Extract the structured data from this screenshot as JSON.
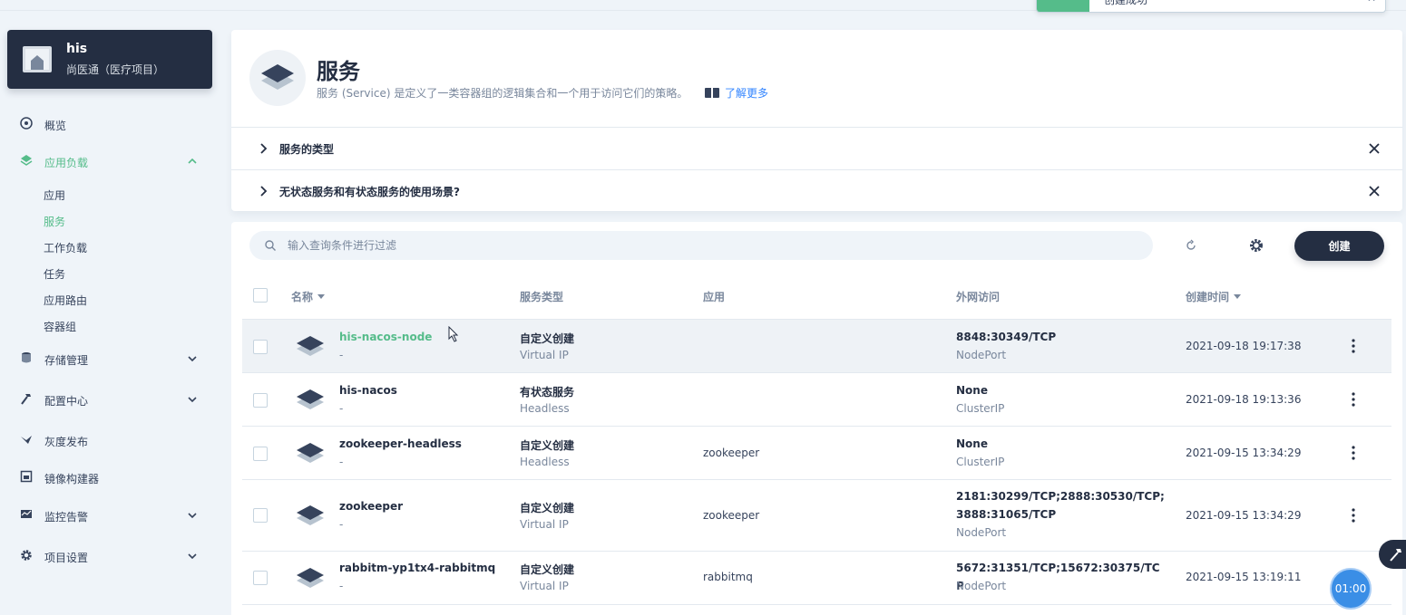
{
  "toast": {
    "text": "创建成功"
  },
  "project": {
    "name": "his",
    "description": "尚医通（医疗项目）"
  },
  "nav": {
    "overview": "概览",
    "workloads": "应用负载",
    "workload_items": [
      "应用",
      "服务",
      "工作负载",
      "任务",
      "应用路由",
      "容器组"
    ],
    "storage": "存储管理",
    "config": "配置中心",
    "grayscale": "灰度发布",
    "image_builder": "镜像构建器",
    "monitoring": "监控告警",
    "project_settings": "项目设置"
  },
  "header": {
    "title": "服务",
    "description": "服务 (Service) 是定义了一类容器组的逻辑集合和一个用于访问它们的策略。",
    "learn_more": "了解更多"
  },
  "tips": [
    {
      "label": "服务的类型"
    },
    {
      "label": "无状态服务和有状态服务的使用场景?"
    }
  ],
  "toolbar": {
    "search_placeholder": "输入查询条件进行过滤",
    "create_label": "创建"
  },
  "table": {
    "columns": [
      "名称",
      "服务类型",
      "应用",
      "外网访问",
      "创建时间"
    ],
    "rows": [
      {
        "name": "his-nacos-node",
        "alias": "-",
        "type": "自定义创建",
        "subtype": "Virtual IP",
        "app": "",
        "access": "8848:30349/TCP",
        "access_type": "NodePort",
        "created": "2021-09-18 19:17:38"
      },
      {
        "name": "his-nacos",
        "alias": "-",
        "type": "有状态服务",
        "subtype": "Headless",
        "app": "",
        "access": "None",
        "access_type": "ClusterIP",
        "created": "2021-09-18 19:13:36"
      },
      {
        "name": "zookeeper-headless",
        "alias": "-",
        "type": "自定义创建",
        "subtype": "Headless",
        "app": "zookeeper",
        "access": "None",
        "access_type": "ClusterIP",
        "created": "2021-09-15 13:34:29"
      },
      {
        "name": "zookeeper",
        "alias": "-",
        "type": "自定义创建",
        "subtype": "Virtual IP",
        "app": "zookeeper",
        "access": "2181:30299/TCP;2888:30530/TCP;3888:31065/TCP",
        "access_type": "NodePort",
        "created": "2021-09-15 13:34:29"
      },
      {
        "name": "rabbitm-yp1tx4-rabbitmq",
        "alias": "-",
        "type": "自定义创建",
        "subtype": "Virtual IP",
        "app": "rabbitmq",
        "access": "5672:31351/TCP;15672:30375/TCP",
        "access_type": "NodePort",
        "created": "2021-09-15 13:19:11"
      }
    ]
  },
  "timer": "01:00",
  "colors": {
    "accent": "#55bc8a",
    "dark": "#242e42",
    "muted": "#79879c",
    "link": "#3385ff"
  }
}
